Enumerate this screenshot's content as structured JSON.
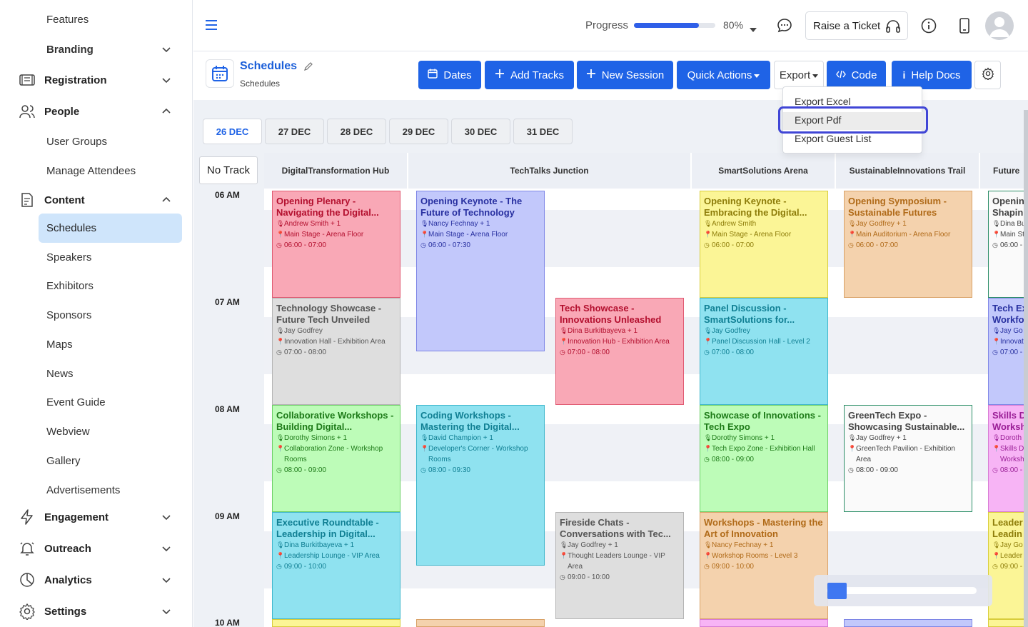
{
  "sidebar": {
    "features": "Features",
    "branding": "Branding",
    "registration": "Registration",
    "people": "People",
    "user_groups": "User Groups",
    "manage_attendees": "Manage Attendees",
    "content": "Content",
    "schedules": "Schedules",
    "speakers": "Speakers",
    "exhibitors": "Exhibitors",
    "sponsors": "Sponsors",
    "maps": "Maps",
    "news": "News",
    "event_guide": "Event Guide",
    "webview": "Webview",
    "gallery": "Gallery",
    "advertisements": "Advertisements",
    "engagement": "Engagement",
    "outreach": "Outreach",
    "analytics": "Analytics",
    "settings": "Settings"
  },
  "header": {
    "progress_label": "Progress",
    "progress_value": "80%",
    "progress_fraction": 0.8,
    "raise_ticket": "Raise a Ticket",
    "accent": "#1f63e6"
  },
  "page": {
    "title": "Schedules",
    "subtitle": "Schedules"
  },
  "toolbar": {
    "dates": "Dates",
    "add_tracks": "Add Tracks",
    "new_session": "New Session",
    "quick_actions": "Quick Actions",
    "export": "Export",
    "code": "Code",
    "help_docs": "Help Docs"
  },
  "export_menu": {
    "excel": "Export Excel",
    "pdf": "Export Pdf",
    "guest_list": "Export Guest List"
  },
  "date_tabs": [
    "26 DEC",
    "27 DEC",
    "28 DEC",
    "29 DEC",
    "30 DEC",
    "31 DEC"
  ],
  "no_track": "No Track",
  "tracks": [
    "DigitalTransformation Hub",
    "TechTalks Junction",
    "SmartSolutions Arena",
    "SustainableInnovations Trail",
    "Future"
  ],
  "times": [
    "06 AM",
    "07 AM",
    "08 AM",
    "09 AM",
    "10 AM"
  ],
  "sessions": {
    "s1": {
      "title": "Opening Plenary - Navigating the Digital...",
      "speaker": "Andrew Smith + 1",
      "location": "Main Stage - Arena Floor",
      "time": "06:00 - 07:00"
    },
    "s2": {
      "title": "Opening Keynote - The Future of Technology",
      "speaker": "Nancy Fechnay + 1",
      "location": "Main Stage - Arena Floor",
      "time": "06:00 - 07:30"
    },
    "s3": {
      "title": "Opening Keynote - Embracing the Digital...",
      "speaker": "Andrew Smith",
      "location": "Main Stage - Arena Floor",
      "time": "06:00 - 07:00"
    },
    "s4": {
      "title": "Opening Symposium - Sustainable Futures",
      "speaker": "Jay Godfrey + 1",
      "location": "Main Auditorium - Arena Floor",
      "time": "06:00 - 07:00"
    },
    "s5": {
      "title": "Openin Shapin",
      "speaker": "Dina Bu",
      "location": "Main St",
      "time": "06:00 -"
    },
    "s6": {
      "title": "Technology Showcase - Future Tech Unveiled",
      "speaker": "Jay Godfrey",
      "location": "Innovation Hall - Exhibition Area",
      "time": "07:00 - 08:00"
    },
    "s7": {
      "title": "Tech Showcase - Innovations Unleashed",
      "speaker": "Dina Burkitbayeva + 1",
      "location": "Innovation Hub - Exhibition Area",
      "time": "07:00 - 08:00"
    },
    "s8": {
      "title": "Panel Discussion - SmartSolutions for...",
      "speaker": "Jay Godfrey",
      "location": "Panel Discussion Hall - Level 2",
      "time": "07:00 - 08:00"
    },
    "s9": {
      "title": "Tech Ex Workfo",
      "speaker": "Jay Go",
      "location": "Innovat",
      "time": "07:00 -"
    },
    "s10": {
      "title": "Collaborative Workshops - Building Digital...",
      "speaker": "Dorothy Simons + 1",
      "location": "Collaboration Zone - Workshop Rooms",
      "time": "08:00 - 09:00"
    },
    "s11": {
      "title": "Coding Workshops - Mastering the Digital...",
      "speaker": "David Champion + 1",
      "location": "Developer's Corner - Workshop Rooms",
      "time": "08:00 - 09:30"
    },
    "s12": {
      "title": "Showcase of Innovations - Tech Expo",
      "speaker": "Dorothy Simons + 1",
      "location": "Tech Expo Zone - Exhibition Hall",
      "time": "08:00 - 09:00"
    },
    "s13": {
      "title": "GreenTech Expo - Showcasing Sustainable...",
      "speaker": "Jay Godfrey + 1",
      "location": "GreenTech Pavilion - Exhibition Area",
      "time": "08:00 - 09:00"
    },
    "s14": {
      "title": "Skills D Worksh",
      "speaker": "Doroth",
      "location": "Skills D Worksho",
      "time": "08:00 -"
    },
    "s15": {
      "title": "Executive Roundtable - Leadership in Digital...",
      "speaker": "Dina Burkitbayeva + 1",
      "location": "Leadership Lounge - VIP Area",
      "time": "09:00 - 10:00"
    },
    "s16": {
      "title": "Fireside Chats - Conversations with Tec...",
      "speaker": "Jay Godfrey + 1",
      "location": "Thought Leaders Lounge - VIP Area",
      "time": "09:00 - 10:00"
    },
    "s17": {
      "title": "Workshops - Mastering the Art of Innovation",
      "speaker": "Nancy Fechnay + 1",
      "location": "Workshop Rooms - Level 3",
      "time": "09:00 - 10:00"
    },
    "s18": {
      "title": "Leader Leadin",
      "speaker": "Jay Go",
      "location": "Leader",
      "time": "09:00 -"
    }
  }
}
